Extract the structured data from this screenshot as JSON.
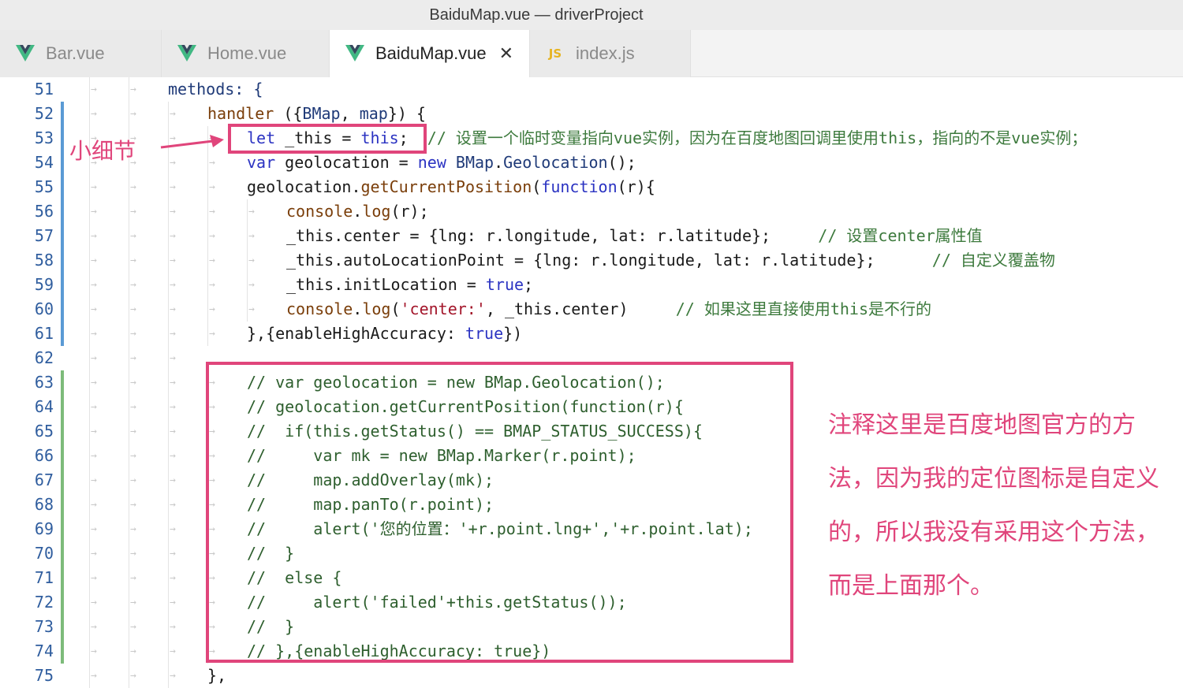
{
  "window": {
    "title": "BaiduMap.vue — driverProject"
  },
  "tabs": [
    {
      "label": "Bar.vue",
      "icon": "vue-icon",
      "active": false
    },
    {
      "label": "Home.vue",
      "icon": "vue-icon",
      "active": false
    },
    {
      "label": "BaiduMap.vue",
      "icon": "vue-icon",
      "active": true,
      "close": "✕"
    },
    {
      "label": "index.js",
      "icon": "js-icon",
      "icon_text": "JS",
      "active": false
    }
  ],
  "annotations": {
    "left": "小细节",
    "right": "注释这里是百度地图官方的方法，因为我的定位图标是自定义的，所以我没有采用这个方法，而是上面那个。"
  },
  "colors": {
    "accent": "#e0457b",
    "vue_green": "#41b883",
    "vue_dark": "#35495e",
    "modified_bar": "#5b9bd5",
    "added_bar": "#7dbb7a"
  },
  "lines": [
    {
      "n": "51",
      "indent": 2,
      "tokens": [
        [
          "methods: {",
          "fn"
        ]
      ]
    },
    {
      "n": "52",
      "indent": 3,
      "tokens": [
        [
          "handler",
          "meth"
        ],
        [
          " ({",
          "id"
        ],
        [
          "BMap",
          "fn"
        ],
        [
          ", ",
          "id"
        ],
        [
          "map",
          "fn"
        ],
        [
          "}) {",
          "id"
        ]
      ]
    },
    {
      "n": "53",
      "indent": 4,
      "tokens": [
        [
          "let",
          "kw"
        ],
        [
          " _this = ",
          "id"
        ],
        [
          "this",
          "kw"
        ],
        [
          ";",
          "id"
        ],
        [
          "  // 设置一个临时变量指向vue实例，因为在百度地图回调里使用this，指向的不是vue实例；",
          "cm"
        ]
      ]
    },
    {
      "n": "54",
      "indent": 4,
      "tokens": [
        [
          "var",
          "kw"
        ],
        [
          " geolocation = ",
          "id"
        ],
        [
          "new",
          "kw"
        ],
        [
          " ",
          "id"
        ],
        [
          "BMap",
          "fn"
        ],
        [
          ".",
          "id"
        ],
        [
          "Geolocation",
          "fn"
        ],
        [
          "();",
          "id"
        ]
      ]
    },
    {
      "n": "55",
      "indent": 4,
      "tokens": [
        [
          "geolocation.",
          "id"
        ],
        [
          "getCurrentPosition",
          "meth"
        ],
        [
          "(",
          "id"
        ],
        [
          "function",
          "kw"
        ],
        [
          "(r){",
          "id"
        ]
      ]
    },
    {
      "n": "56",
      "indent": 5,
      "tokens": [
        [
          "console",
          "meth"
        ],
        [
          ".",
          "id"
        ],
        [
          "log",
          "meth"
        ],
        [
          "(r);",
          "id"
        ]
      ]
    },
    {
      "n": "57",
      "indent": 5,
      "tokens": [
        [
          "_this.center = {lng: r.longitude, lat: r.latitude};",
          "id"
        ],
        [
          "     // 设置center属性值",
          "cm"
        ]
      ]
    },
    {
      "n": "58",
      "indent": 5,
      "tokens": [
        [
          "_this.autoLocationPoint = {lng: r.longitude, lat: r.latitude};",
          "id"
        ],
        [
          "      // 自定义覆盖物",
          "cm"
        ]
      ]
    },
    {
      "n": "59",
      "indent": 5,
      "tokens": [
        [
          "_this.initLocation = ",
          "id"
        ],
        [
          "true",
          "kw"
        ],
        [
          ";",
          "id"
        ]
      ]
    },
    {
      "n": "60",
      "indent": 5,
      "tokens": [
        [
          "console",
          "meth"
        ],
        [
          ".",
          "id"
        ],
        [
          "log",
          "meth"
        ],
        [
          "(",
          "id"
        ],
        [
          "'center:'",
          "str"
        ],
        [
          ", _this.center)",
          "id"
        ],
        [
          "     // 如果这里直接使用this是不行的",
          "cm"
        ]
      ]
    },
    {
      "n": "61",
      "indent": 4,
      "tokens": [
        [
          "},{enableHighAccuracy: ",
          "id"
        ],
        [
          "true",
          "kw"
        ],
        [
          "})",
          "id"
        ]
      ]
    },
    {
      "n": "62",
      "indent": 3,
      "tokens": []
    },
    {
      "n": "63",
      "indent": 4,
      "tokens": [
        [
          "// var geolocation = new BMap.Geolocation();",
          "cmt"
        ]
      ]
    },
    {
      "n": "64",
      "indent": 4,
      "tokens": [
        [
          "// geolocation.getCurrentPosition(function(r){",
          "cmt"
        ]
      ]
    },
    {
      "n": "65",
      "indent": 4,
      "tokens": [
        [
          "//  if(this.getStatus() == BMAP_STATUS_SUCCESS){",
          "cmt"
        ]
      ]
    },
    {
      "n": "66",
      "indent": 4,
      "tokens": [
        [
          "//     var mk = new BMap.Marker(r.point);",
          "cmt"
        ]
      ]
    },
    {
      "n": "67",
      "indent": 4,
      "tokens": [
        [
          "//     map.addOverlay(mk);",
          "cmt"
        ]
      ]
    },
    {
      "n": "68",
      "indent": 4,
      "tokens": [
        [
          "//     map.panTo(r.point);",
          "cmt"
        ]
      ]
    },
    {
      "n": "69",
      "indent": 4,
      "tokens": [
        [
          "//     alert('您的位置：'+r.point.lng+','+r.point.lat);",
          "cmt"
        ]
      ]
    },
    {
      "n": "70",
      "indent": 4,
      "tokens": [
        [
          "//  }",
          "cmt"
        ]
      ]
    },
    {
      "n": "71",
      "indent": 4,
      "tokens": [
        [
          "//  else {",
          "cmt"
        ]
      ]
    },
    {
      "n": "72",
      "indent": 4,
      "tokens": [
        [
          "//     alert('failed'+this.getStatus());",
          "cmt"
        ]
      ]
    },
    {
      "n": "73",
      "indent": 4,
      "tokens": [
        [
          "//  }",
          "cmt"
        ]
      ]
    },
    {
      "n": "74",
      "indent": 4,
      "tokens": [
        [
          "// },{enableHighAccuracy: true})",
          "cmt"
        ]
      ]
    },
    {
      "n": "75",
      "indent": 3,
      "tokens": [
        [
          "},",
          "id"
        ]
      ]
    }
  ]
}
